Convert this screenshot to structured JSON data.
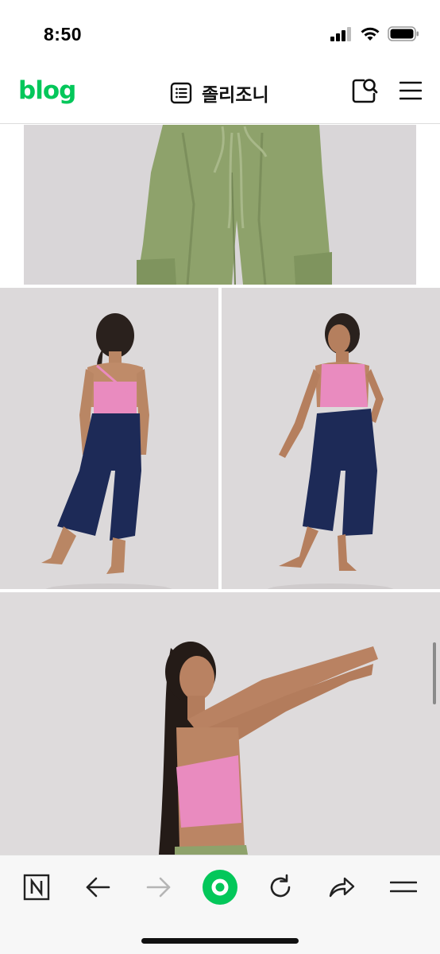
{
  "status_bar": {
    "time": "8:50",
    "icons": [
      "cellular-signal-icon",
      "wifi-icon",
      "battery-icon"
    ]
  },
  "header": {
    "logo": "blog",
    "title": "졸리조니",
    "icons": [
      "post-list-icon",
      "search-icon",
      "hamburger-menu-icon"
    ]
  },
  "content": {
    "photos": [
      "model-green-cargo-pants",
      "model-pink-top-navy-pants-back",
      "model-pink-top-navy-pants-front",
      "model-pink-top-stretching"
    ]
  },
  "toolbar": {
    "buttons": [
      "naver-icon",
      "back-arrow-icon",
      "forward-arrow-icon",
      "naver-home-icon",
      "refresh-icon",
      "share-icon",
      "menu-icon"
    ]
  },
  "colors": {
    "brand_green": "#03c75a",
    "photo_background": "#d8d5d6",
    "toolbar_background": "#f7f7f7"
  }
}
